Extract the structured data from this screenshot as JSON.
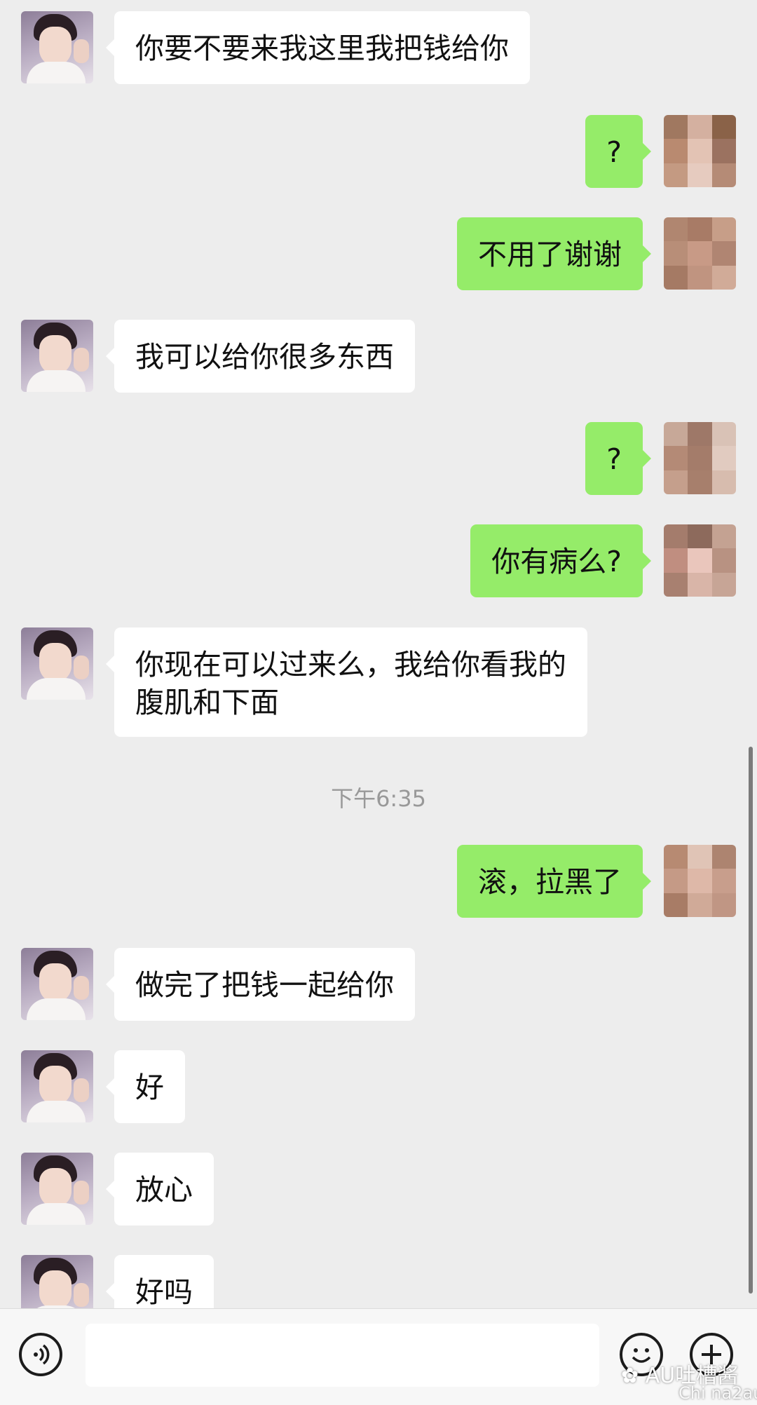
{
  "messages": [
    {
      "side": "left",
      "text": "你要不要来我这里我把钱给你"
    },
    {
      "side": "right",
      "text": "?"
    },
    {
      "side": "right",
      "text": "不用了谢谢"
    },
    {
      "side": "left",
      "text": "我可以给你很多东西"
    },
    {
      "side": "right",
      "text": "?"
    },
    {
      "side": "right",
      "text": "你有病么?"
    },
    {
      "side": "left",
      "text": "你现在可以过来么，我给你看我的\n腹肌和下面"
    },
    {
      "side": "right",
      "text": "滚，拉黑了"
    },
    {
      "side": "left",
      "text": "做完了把钱一起给你"
    },
    {
      "side": "left",
      "text": "好"
    },
    {
      "side": "left",
      "text": "放心"
    },
    {
      "side": "left",
      "text": "好吗"
    }
  ],
  "timestamp": "下午6:35",
  "input_bar": {
    "icons": [
      "voice-icon",
      "emoji-icon",
      "plus-icon"
    ]
  },
  "watermark": {
    "text": "AU吐槽酱",
    "sub": "Chi na2au"
  },
  "colors": {
    "background": "#ededed",
    "sent_bubble": "#95ec69",
    "received_bubble": "#ffffff",
    "timestamp": "#999999"
  }
}
